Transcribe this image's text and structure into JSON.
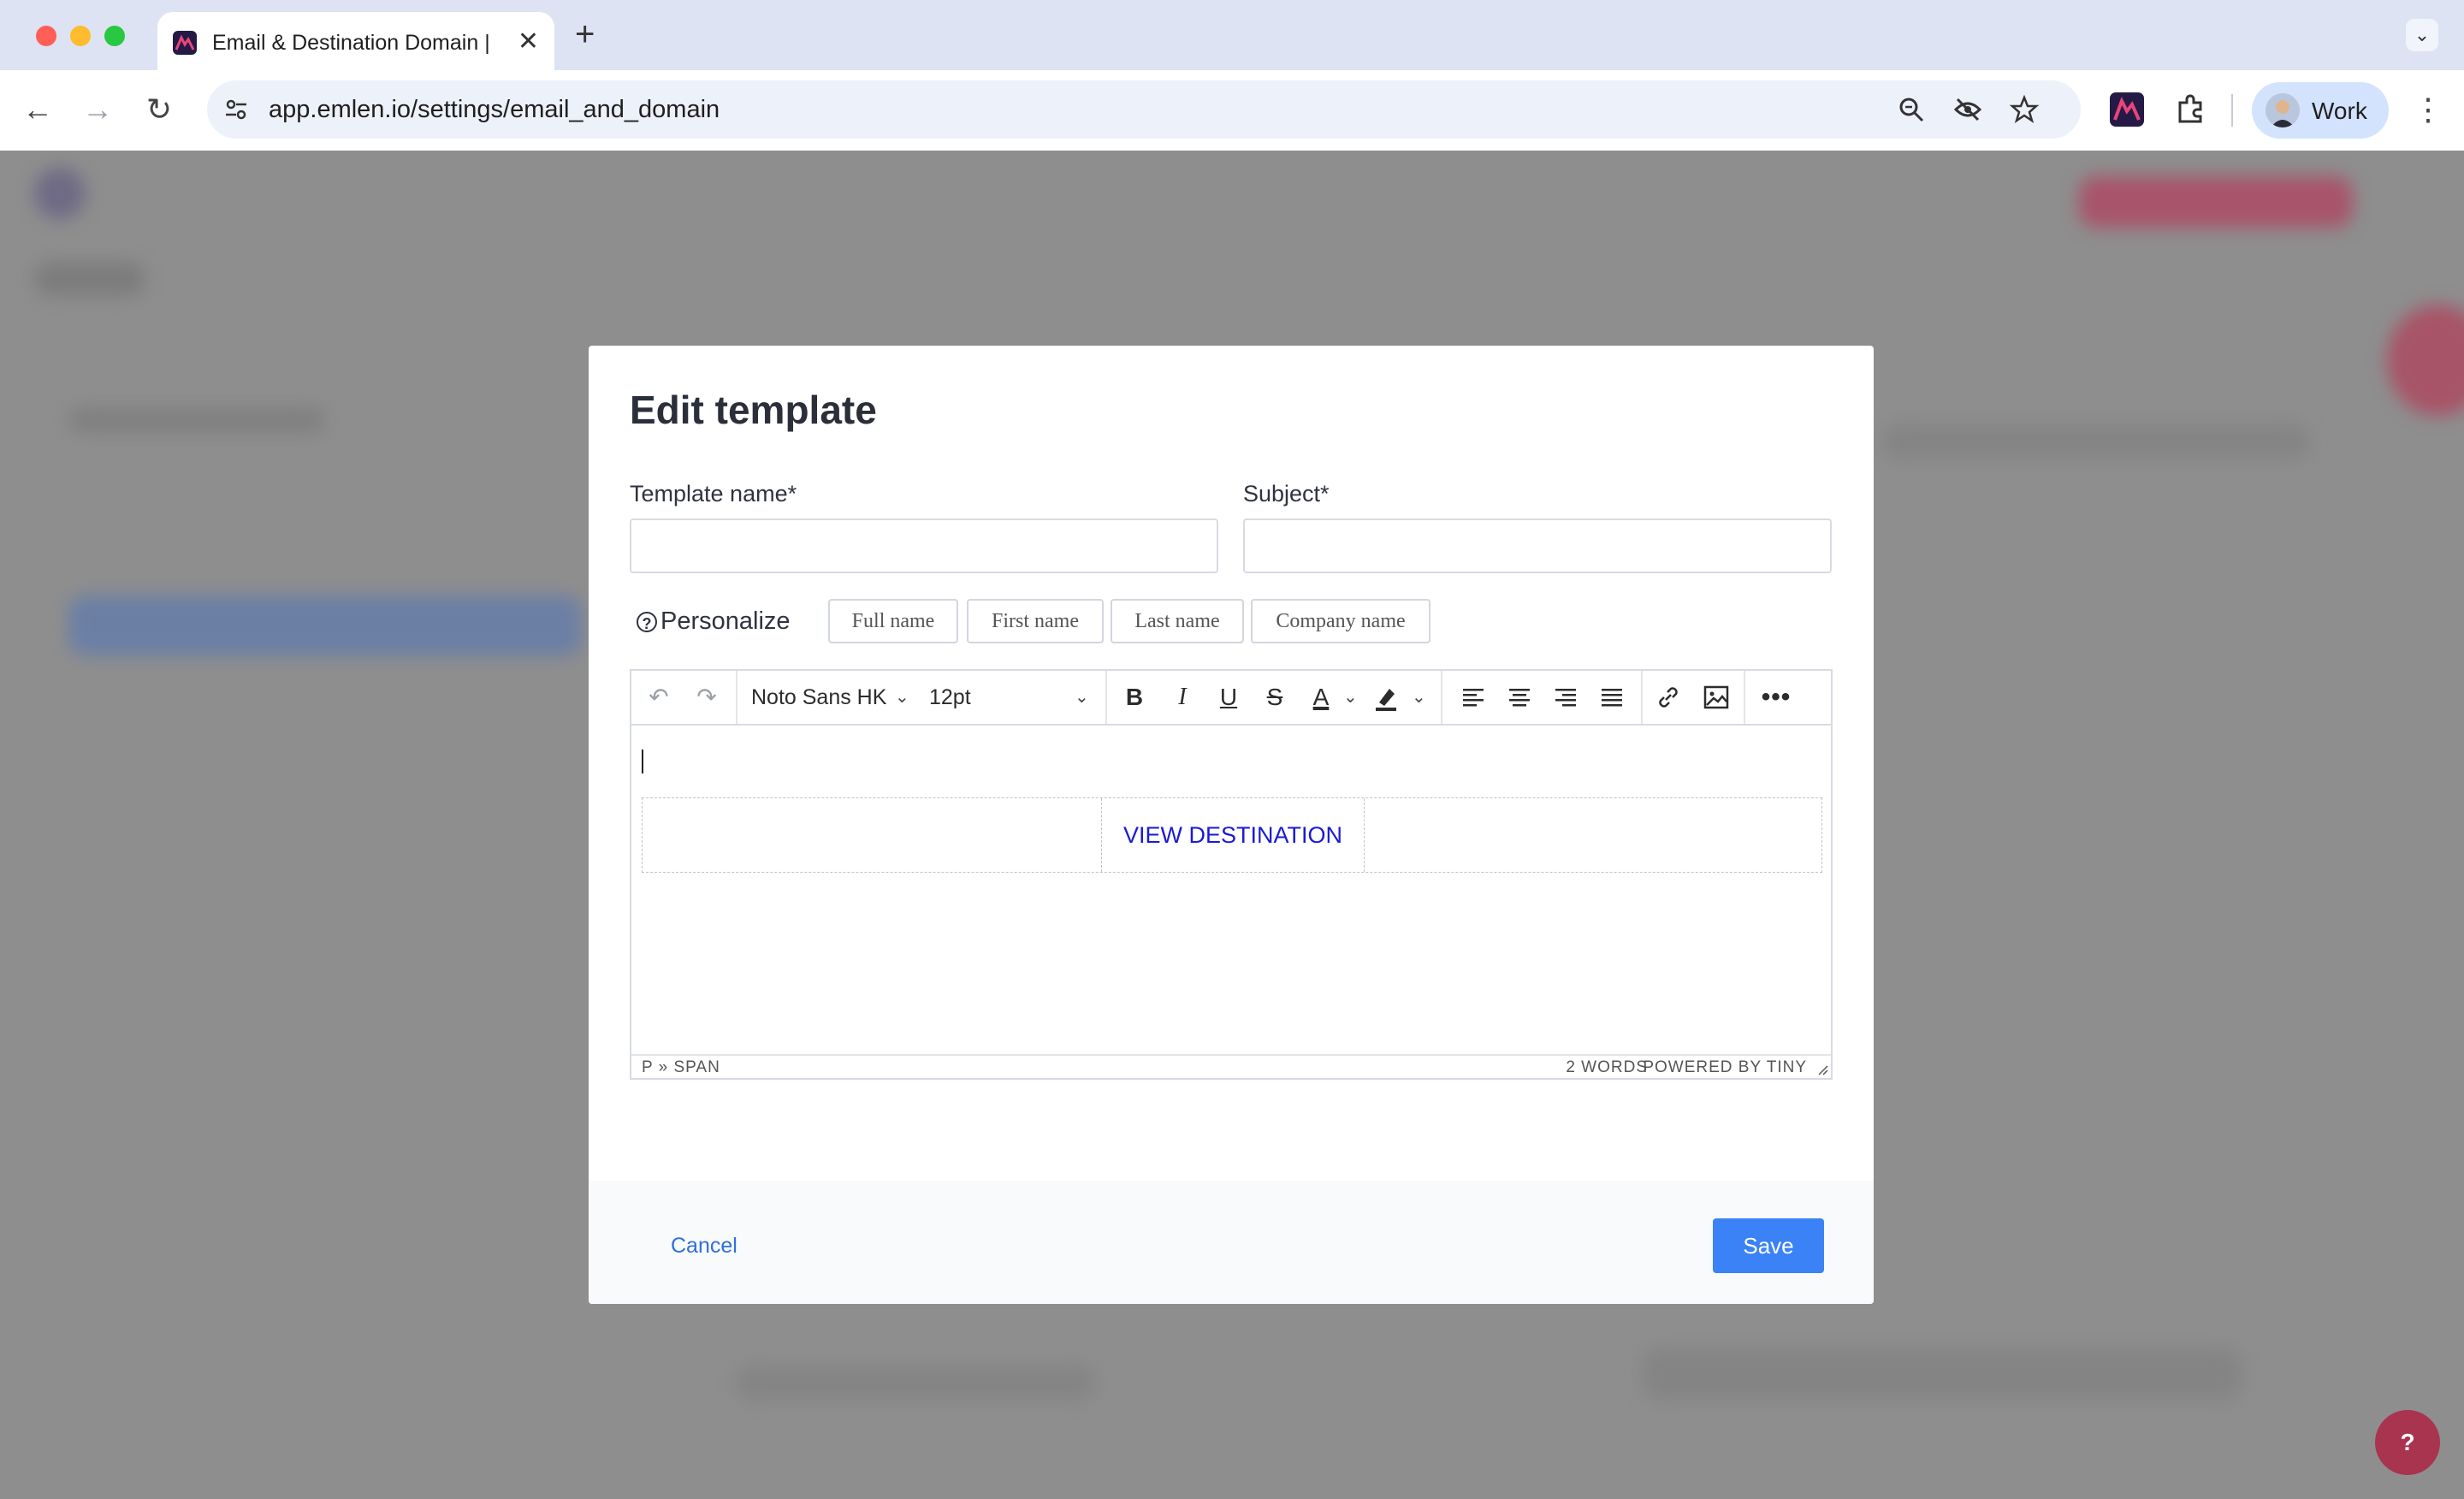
{
  "browser": {
    "tab_title": "Email & Destination Domain |",
    "new_tab_symbol": "+",
    "url": "app.emlen.io/settings/email_and_domain",
    "profile_label": "Work"
  },
  "modal": {
    "title": "Edit template",
    "template_name_label": "Template name*",
    "template_name_value": "",
    "subject_label": "Subject*",
    "subject_value": "",
    "personalize_label": "Personalize",
    "personalize_tags": [
      "Full name",
      "First name",
      "Last name",
      "Company name"
    ],
    "cancel_label": "Cancel",
    "save_label": "Save"
  },
  "editor": {
    "font_family": "Noto Sans HK",
    "font_size": "12pt",
    "button_label": "VIEW DESTINATION",
    "status_path": "P » SPAN",
    "word_count": "2 WORDS",
    "powered_by": "POWERED BY TINY"
  },
  "help": {
    "label": "?"
  },
  "colors": {
    "accent": "#3b82f6",
    "link": "#2f6fde",
    "destination_link": "#1a1ad6",
    "help_button": "#a8344f"
  },
  "icons": {
    "toolbar": [
      "undo-icon",
      "redo-icon",
      "bold-icon",
      "italic-icon",
      "underline-icon",
      "strikethrough-icon",
      "text-color-icon",
      "highlight-icon",
      "align-left-icon",
      "align-center-icon",
      "align-right-icon",
      "align-justify-icon",
      "link-icon",
      "image-icon",
      "more-icon"
    ],
    "browser": [
      "back-icon",
      "forward-icon",
      "reload-icon",
      "site-info-icon",
      "zoom-icon",
      "eye-off-icon",
      "star-icon",
      "extension-emlen-icon",
      "extensions-puzzle-icon",
      "kebab-menu-icon"
    ]
  }
}
